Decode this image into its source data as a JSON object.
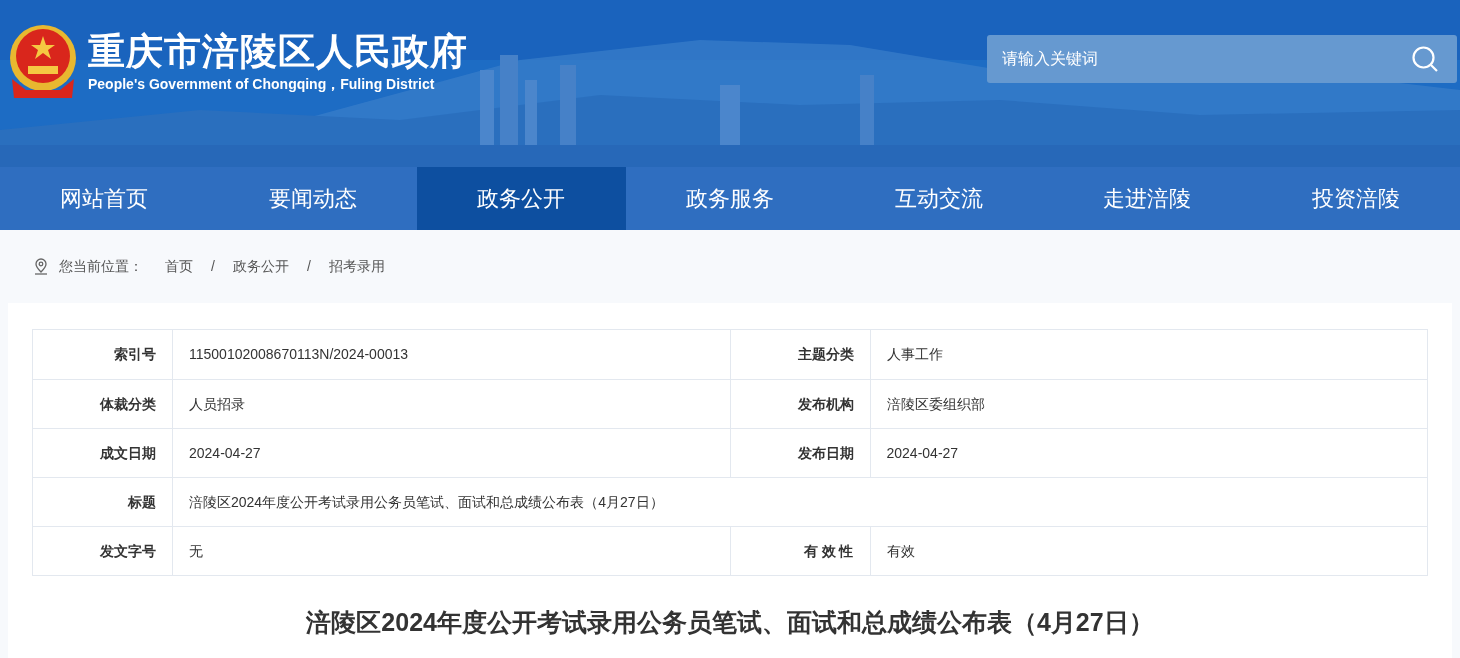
{
  "header": {
    "title": "重庆市涪陵区人民政府",
    "subtitle": "People's Government of Chongqing，Fuling District",
    "search": {
      "placeholder": "请输入关键词"
    }
  },
  "nav": [
    {
      "label": "网站首页",
      "selected": false
    },
    {
      "label": "要闻动态",
      "selected": false
    },
    {
      "label": "政务公开",
      "selected": true
    },
    {
      "label": "政务服务",
      "selected": false
    },
    {
      "label": "互动交流",
      "selected": false
    },
    {
      "label": "走进涪陵",
      "selected": false
    },
    {
      "label": "投资涪陵",
      "selected": false
    }
  ],
  "breadcrumb": {
    "label": "您当前位置：",
    "separator": "/",
    "items": [
      "首页",
      "政务公开",
      "招考录用"
    ]
  },
  "meta_table": [
    {
      "kind": "pair",
      "cells": [
        {
          "label": "索引号",
          "value": "11500102008670113N/2024-00013"
        },
        {
          "label": "主题分类",
          "value": "人事工作"
        }
      ]
    },
    {
      "kind": "pair",
      "cells": [
        {
          "label": "体裁分类",
          "value": "人员招录"
        },
        {
          "label": "发布机构",
          "value": "涪陵区委组织部"
        }
      ]
    },
    {
      "kind": "pair",
      "cells": [
        {
          "label": "成文日期",
          "value": "2024-04-27"
        },
        {
          "label": "发布日期",
          "value": "2024-04-27"
        }
      ]
    },
    {
      "kind": "full",
      "cells": [
        {
          "label": "标题",
          "value": "涪陵区2024年度公开考试录用公务员笔试、面试和总成绩公布表（4月27日）"
        }
      ]
    },
    {
      "kind": "pair",
      "cells": [
        {
          "label": "发文字号",
          "value": "无"
        },
        {
          "label": "有 效 性",
          "value": "有效"
        }
      ]
    }
  ],
  "article_title": "涪陵区2024年度公开考试录用公务员笔试、面试和总成绩公布表（4月27日）"
}
